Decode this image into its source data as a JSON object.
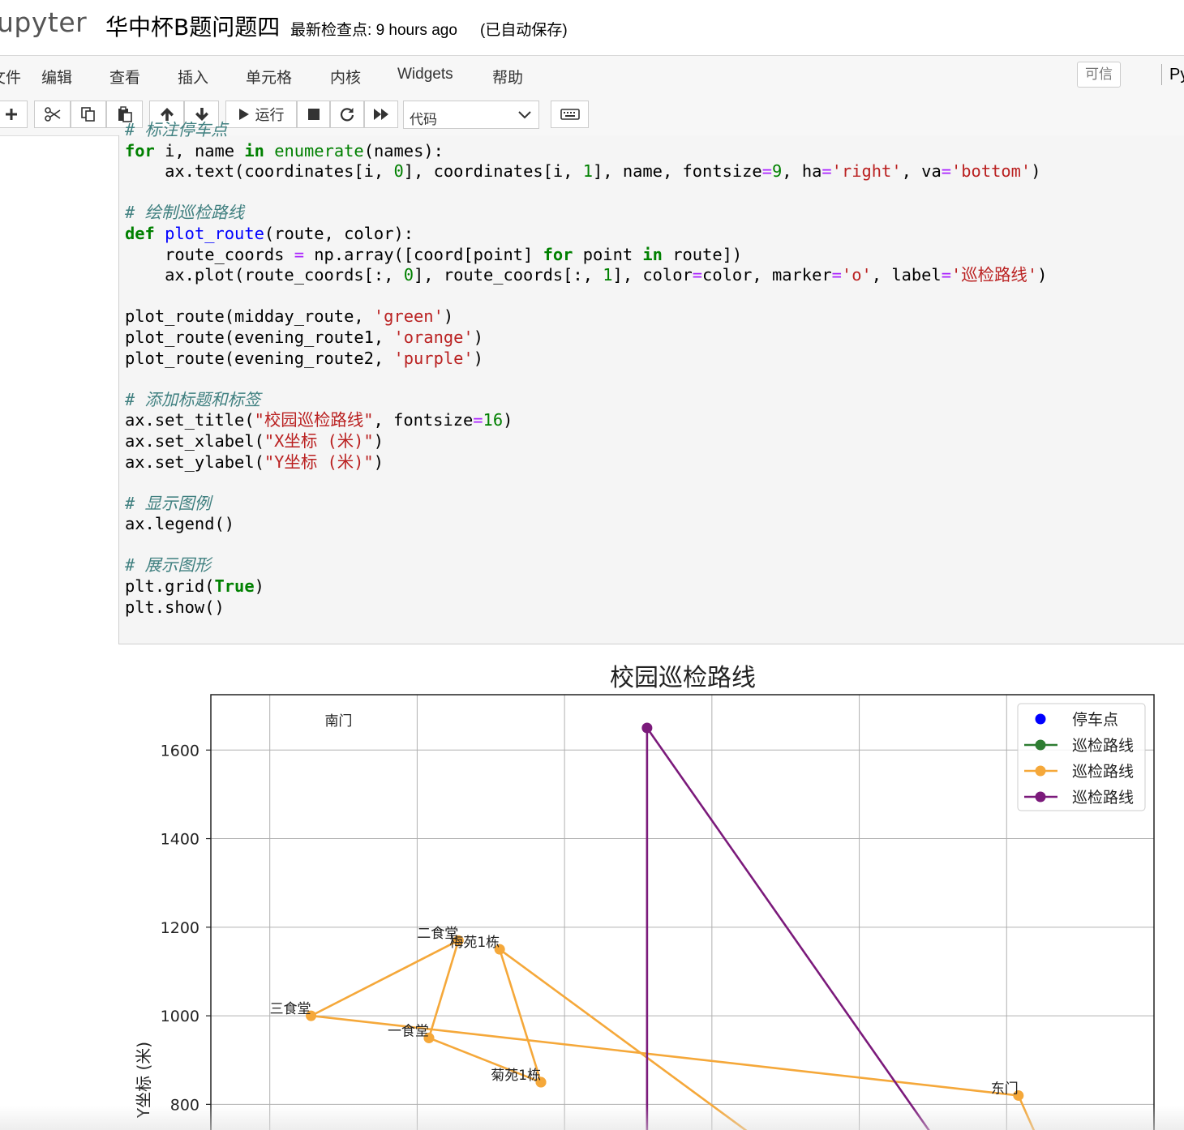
{
  "header": {
    "logo_text": "upyter",
    "notebook_name": "华中杯B题问题四",
    "checkpoint_label": "最新检查点:",
    "checkpoint_time": "9 hours ago",
    "autosave_status": "(已自动保存)"
  },
  "menubar": {
    "items": [
      "文件",
      "编辑",
      "查看",
      "插入",
      "单元格",
      "内核",
      "Widgets",
      "帮助"
    ],
    "trusted_label": "可信",
    "kernel_label": "Py"
  },
  "toolbar": {
    "run_label": "运行",
    "cell_type": "代码",
    "icons": [
      "plus-icon",
      "scissors-icon",
      "copy-icon",
      "paste-icon",
      "arrow-up-icon",
      "arrow-down-icon",
      "run-icon",
      "stop-icon",
      "restart-icon",
      "fast-forward-icon",
      "keyboard-icon"
    ]
  },
  "code_cell": {
    "lines": [
      "# 标注停车点",
      "for i, name in enumerate(names):",
      "    ax.text(coordinates[i, 0], coordinates[i, 1], name, fontsize=9, ha='right', va='bottom')",
      "",
      "# 绘制巡检路线",
      "def plot_route(route, color):",
      "    route_coords = np.array([coord[point] for point in route])",
      "    ax.plot(route_coords[:, 0], route_coords[:, 1], color=color, marker='o', label='巡检路线')",
      "",
      "plot_route(midday_route, 'green')",
      "plot_route(evening_route1, 'orange')",
      "plot_route(evening_route2, 'purple')",
      "",
      "# 添加标题和标签",
      "ax.set_title(\"校园巡检路线\", fontsize=16)",
      "ax.set_xlabel(\"X坐标 (米)\")",
      "ax.set_ylabel(\"Y坐标 (米)\")",
      "",
      "# 显示图例",
      "ax.legend()",
      "",
      "# 展示图形",
      "plt.grid(True)",
      "plt.show()"
    ]
  },
  "chart_data": {
    "type": "line",
    "title": "校园巡检路线",
    "ylabel": "Y坐标 (米)",
    "ylim": [
      700,
      1725
    ],
    "yticks": [
      800,
      1000,
      1200,
      1400,
      1600
    ],
    "grid": true,
    "legend_position": "top-right",
    "legend": [
      {
        "label": "停车点",
        "color": "#0000ff",
        "style": "dot"
      },
      {
        "label": "巡检路线",
        "color": "#2e7d32",
        "style": "line-marker"
      },
      {
        "label": "巡检路线",
        "color": "#f5a83a",
        "style": "line-marker"
      },
      {
        "label": "巡检路线",
        "color": "#7b1a7b",
        "style": "line-marker"
      }
    ],
    "point_labels": [
      {
        "name": "南门",
        "x": 940,
        "y": 1650
      },
      {
        "name": "二食堂",
        "x": 1120,
        "y": 1170
      },
      {
        "name": "梅苑1栋",
        "x": 1190,
        "y": 1150
      },
      {
        "name": "三食堂",
        "x": 870,
        "y": 1000
      },
      {
        "name": "一食堂",
        "x": 1070,
        "y": 950
      },
      {
        "name": "菊苑1栋",
        "x": 1260,
        "y": 850
      },
      {
        "name": "东门",
        "x": 2070,
        "y": 820
      }
    ],
    "series": [
      {
        "name": "巡检路线",
        "color": "#f5a83a",
        "points": [
          [
            1260,
            850
          ],
          [
            1190,
            1150
          ],
          [
            1650,
            700
          ]
        ]
      },
      {
        "name": "巡检路线",
        "color": "#f5a83a",
        "points": [
          [
            1070,
            950
          ],
          [
            1260,
            850
          ]
        ]
      },
      {
        "name": "巡检路线",
        "color": "#f5a83a",
        "points": [
          [
            1070,
            950
          ],
          [
            1120,
            1170
          ],
          [
            870,
            1000
          ],
          [
            2070,
            820
          ],
          [
            2110,
            700
          ]
        ]
      },
      {
        "name": "巡检路线",
        "color": "#7b1a7b",
        "points": [
          [
            1940,
            700
          ],
          [
            1440,
            1650
          ],
          [
            1440,
            700
          ]
        ]
      }
    ]
  }
}
